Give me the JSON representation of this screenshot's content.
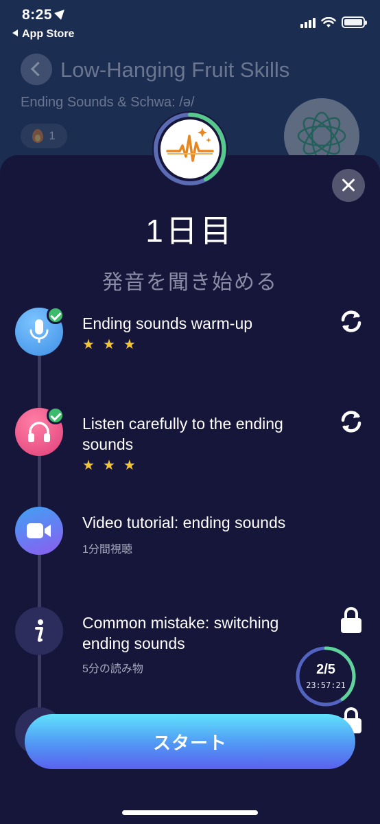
{
  "status_bar": {
    "time": "8:25",
    "back_app": "App Store"
  },
  "background": {
    "title": "Low-Hanging Fruit Skills",
    "subtitle": "Ending Sounds & Schwa: /ə/",
    "streak_count": "1"
  },
  "sheet": {
    "day_title": "1日目",
    "day_subtitle": "発音を聞き始める",
    "steps": [
      {
        "title": "Ending sounds warm-up",
        "meta": "",
        "icon": "microphone-icon",
        "completed": true,
        "stars": 3,
        "action": "replay-icon"
      },
      {
        "title": "Listen carefully to the ending sounds",
        "meta": "",
        "icon": "headphones-icon",
        "completed": true,
        "stars": 3,
        "action": "replay-icon"
      },
      {
        "title": "Video tutorial: ending sounds",
        "meta": "1分間視聴",
        "icon": "video-camera-icon",
        "completed": false,
        "stars": 0,
        "action": ""
      },
      {
        "title": "Common mistake: switching ending sounds",
        "meta": "5分の読み物",
        "icon": "info-icon",
        "completed": false,
        "stars": 0,
        "action": "lock-icon"
      },
      {
        "title": "",
        "meta": "",
        "icon": "sparkle-icon",
        "completed": false,
        "stars": 0,
        "action": "lock-icon"
      }
    ],
    "progress": {
      "count": "2/5",
      "timer": "23:57:21",
      "fraction": 0.4
    },
    "start_button": "スタート"
  },
  "colors": {
    "sheet_bg": "#16163a",
    "accent_green": "#3dbb6c",
    "star_gold": "#f3c531",
    "button_top": "#5fe2fc",
    "button_bottom": "#5a62ee"
  }
}
